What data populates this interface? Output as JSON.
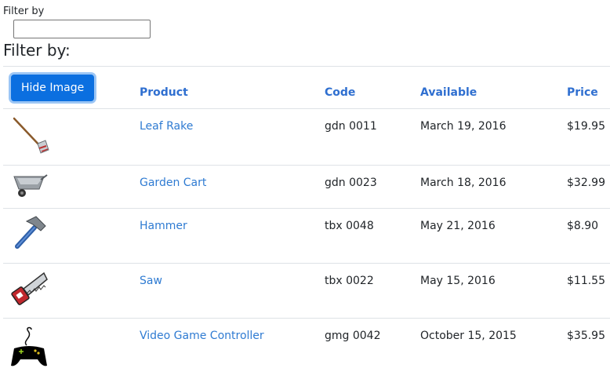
{
  "filter": {
    "label": "Filter by",
    "value": "",
    "heading": "Filter by:"
  },
  "table": {
    "toggle_button": "Hide Image",
    "headers": {
      "product": "Product",
      "code": "Code",
      "available": "Available",
      "price": "Price"
    },
    "rows": [
      {
        "icon": "rake-icon",
        "name": "Leaf Rake",
        "code": "gdn 0011",
        "available": "March 19, 2016",
        "price": "$19.95"
      },
      {
        "icon": "garden-cart-icon",
        "name": "Garden Cart",
        "code": "gdn 0023",
        "available": "March 18, 2016",
        "price": "$32.99"
      },
      {
        "icon": "hammer-icon",
        "name": "Hammer",
        "code": "tbx 0048",
        "available": "May 21, 2016",
        "price": "$8.90"
      },
      {
        "icon": "saw-icon",
        "name": "Saw",
        "code": "tbx 0022",
        "available": "May 15, 2016",
        "price": "$11.55"
      },
      {
        "icon": "game-controller-icon",
        "name": "Video Game Controller",
        "code": "gmg 0042",
        "available": "October 15, 2015",
        "price": "$35.95"
      }
    ]
  },
  "colors": {
    "primary_button": "#0b6fe0",
    "link": "#2f7bd2",
    "header_text": "#2f6fd0"
  }
}
